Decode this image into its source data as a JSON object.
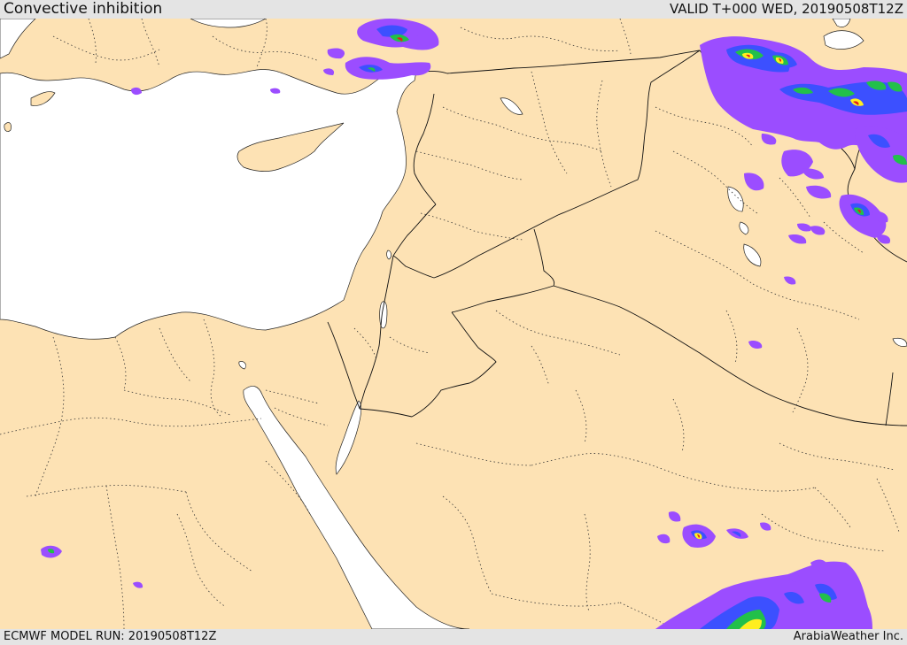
{
  "header": {
    "title": "Convective inhibition",
    "valid": "VALID T+000 WED, 20190508T12Z"
  },
  "footer": {
    "model_run": "ECMWF MODEL RUN: 20190508T12Z",
    "credit": "ArabiaWeather Inc."
  },
  "colors": {
    "land": "#fde2b4",
    "water": "#ffffff",
    "field_low": "#9b4dff",
    "field_mid1": "#3c50ff",
    "field_mid2": "#22c04a",
    "field_mid3": "#ffee20",
    "field_high": "#e3201c"
  }
}
